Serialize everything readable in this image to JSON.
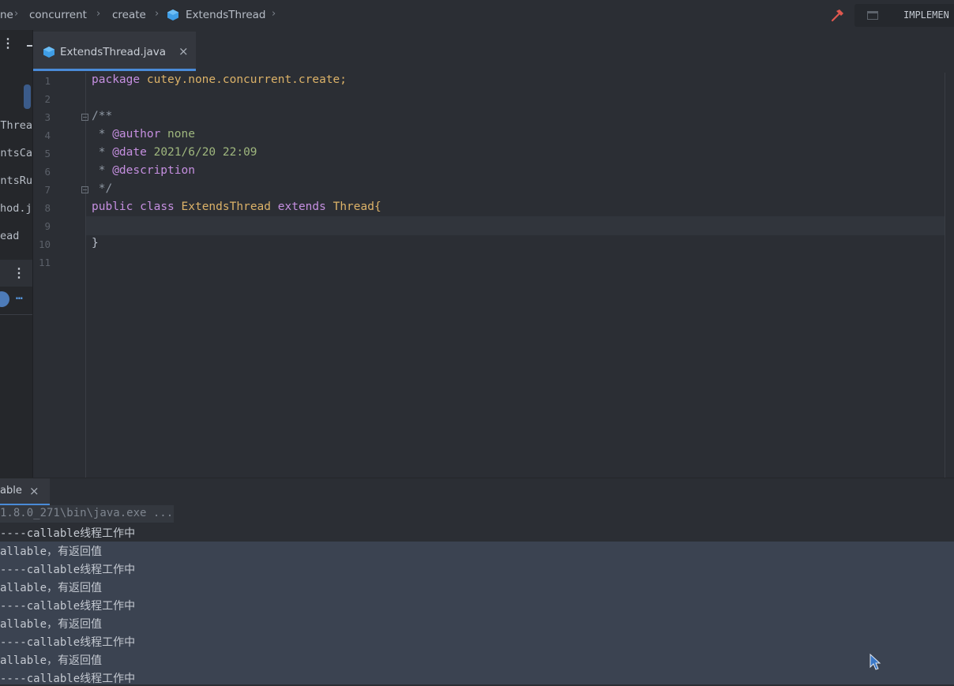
{
  "breadcrumb": {
    "items": [
      "ne",
      "concurrent",
      "create",
      "ExtendsThread"
    ]
  },
  "toolbar": {
    "run_config_label": "IMPLEMEN"
  },
  "project_panel": {
    "items": [
      "sThrea",
      "entsCa",
      "entsRu",
      "hod.j",
      "ead"
    ]
  },
  "editor_tab": {
    "label": "ExtendsThread.java",
    "close": "×"
  },
  "editor": {
    "line_numbers": [
      "1",
      "2",
      "3",
      "4",
      "5",
      "6",
      "7",
      "8",
      "9",
      "10",
      "11"
    ],
    "lines": {
      "l1_kw": "package",
      "l1_pkg": "cutey.none.concurrent.create;",
      "l3": "/**",
      "l4_star": " * ",
      "l4_tag": "@author",
      "l4_val": " none",
      "l5_star": " * ",
      "l5_tag": "@date",
      "l5_val": " 2021/6/20 22:09",
      "l6_star": " * ",
      "l6_tag": "@description",
      "l7": " */",
      "l8_kw1": "public",
      "l8_kw2": "class",
      "l8_cls": "ExtendsThread",
      "l8_kw3": "extends",
      "l8_sup": "Thread{",
      "l10": "}"
    }
  },
  "run_panel": {
    "tab_label": "able",
    "close": "×"
  },
  "console": {
    "lines": [
      "1.8.0_271\\bin\\java.exe ...",
      "----callable线程工作中",
      "allable，有返回值",
      "----callable线程工作中",
      "allable，有返回值",
      "----callable线程工作中",
      "allable，有返回值",
      "----callable线程工作中",
      "allable，有返回值",
      "----callable线程工作中"
    ]
  },
  "colors": {
    "accent": "#4a8bd8",
    "keyword": "#c58fe0",
    "class": "#dcb268",
    "hammer": "#e0584f"
  }
}
